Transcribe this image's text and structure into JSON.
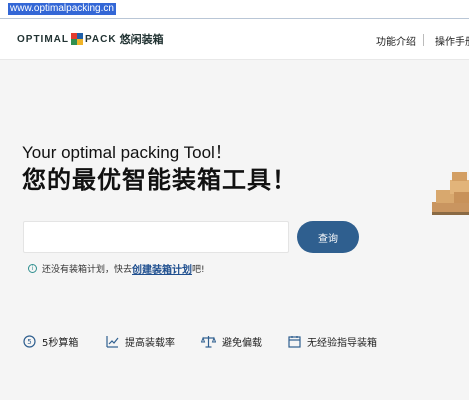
{
  "browser": {
    "url": "www.optimalpacking.cn"
  },
  "header": {
    "logo_left": "OPTIMAL",
    "logo_right": "PACK",
    "logo_cn": "悠闲装箱",
    "nav": [
      "功能介绍",
      "操作手册"
    ]
  },
  "hero": {
    "subtitle": "Your optimal packing Tool！",
    "title": "您的最优智能装箱工具！"
  },
  "search": {
    "value": "",
    "button_label": "查询"
  },
  "hint": {
    "text": "还没有装箱计划，快去",
    "link": "创建装箱计划",
    "suffix": "吧!"
  },
  "features": [
    {
      "icon": "clock-5-icon",
      "label": "5秒算箱"
    },
    {
      "icon": "trend-chart-icon",
      "label": "提高装载率"
    },
    {
      "icon": "scale-icon",
      "label": "避免偏载"
    },
    {
      "icon": "calendar-icon",
      "label": "无经验指导装箱"
    }
  ],
  "colors": {
    "accent": "#2f5f8f",
    "link": "#1f4f8f",
    "background": "#f5f5f5"
  }
}
